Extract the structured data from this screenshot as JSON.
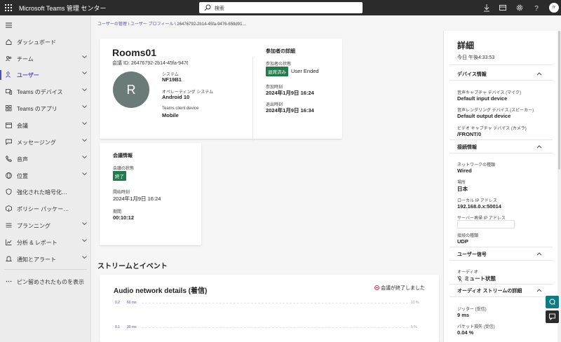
{
  "app": {
    "title": "Microsoft Teams 管理 センター"
  },
  "search": {
    "placeholder": "検索"
  },
  "user": {
    "initials": "IY"
  },
  "nav": {
    "items": [
      {
        "label": "ダッシュボード",
        "icon": "home-icon"
      },
      {
        "label": "チーム",
        "icon": "teams-icon",
        "expandable": true
      },
      {
        "label": "ユーザー",
        "icon": "users-icon",
        "expandable": true,
        "active": true
      },
      {
        "label": "Teams のデバイス",
        "icon": "devices-icon",
        "expandable": true
      },
      {
        "label": "Teams のアプリ",
        "icon": "apps-icon",
        "expandable": true
      },
      {
        "label": "会議",
        "icon": "meetings-icon",
        "expandable": true
      },
      {
        "label": "メッセージング",
        "icon": "messaging-icon",
        "expandable": true
      },
      {
        "label": "音声",
        "icon": "phone-icon",
        "expandable": true
      },
      {
        "label": "位置",
        "icon": "globe-icon",
        "expandable": true
      },
      {
        "label": "強化された暗号化…",
        "icon": "shield-icon"
      },
      {
        "label": "ポリシー パッケー…",
        "icon": "package-icon"
      },
      {
        "label": "プランニング",
        "icon": "planning-icon",
        "expandable": true
      },
      {
        "label": "分析 & レポート",
        "icon": "chart-icon",
        "expandable": true
      },
      {
        "label": "通知とアラート",
        "icon": "bell-icon",
        "expandable": true
      }
    ],
    "show_pinned": "ピン留めされたものを表示"
  },
  "breadcrumb": {
    "items": [
      "ユーザーの管理",
      "ユーザー プロフィール",
      "26476792-2b14-45fa-9476-658d91..."
    ],
    "separator": "\\"
  },
  "participant": {
    "device_name": "Rooms01",
    "meeting_id_label": "会議 ID:",
    "meeting_id": "26476792-2b14-45fa-9476",
    "avatar_letter": "R",
    "system_label": "システム",
    "system": "NF19B1",
    "os_label": "オペレーティング システム",
    "os": "Android 10",
    "client_label": "Teams client device",
    "client": "Mobile"
  },
  "participant_details": {
    "title": "参加者の詳細",
    "status_label": "参加者の状態",
    "status_badge": "退席済み",
    "status_text": "User Ended",
    "join_label": "参加時刻",
    "join": "2024年1月9日 16:24",
    "leave_label": "退出時刻",
    "leave": "2024年1月9日 16:34"
  },
  "meeting_info": {
    "title": "会議情報",
    "status_label": "会議の状態",
    "status_badge": "終了",
    "start_label": "開始時刻",
    "start": "2024年1月9日 16:24",
    "duration_label": "期間",
    "duration": "00:10:12"
  },
  "streams": {
    "title": "ストリームとイベント",
    "chart_title": "Audio network details (着信)",
    "ended_text": "会議が終了しました"
  },
  "chart_data": {
    "type": "line",
    "title": "Audio network details (着信)",
    "y_ticks_left": [
      {
        "value": "0.2",
        "label": "60 ms"
      },
      {
        "value": "0.1",
        "label": "30 ms"
      }
    ],
    "y_ticks_right": [
      "10 %",
      "5 %"
    ],
    "series": []
  },
  "details": {
    "title": "詳細",
    "time": "今日 午後4:33:53",
    "device_info": {
      "title": "デバイス情報",
      "mic_label": "音声キャプチャ デバイス (マイク)",
      "mic": "Default input device",
      "speaker_label": "音声レンダリング デバイス (スピーカー)",
      "speaker": "Default output device",
      "camera_label": "ビデオ キャプチャ デバイス (カメラ)",
      "camera": "/FRONT/0"
    },
    "connection": {
      "title": "接続情報",
      "network_label": "ネットワークの種類",
      "network": "Wired",
      "location_label": "場所",
      "location": "日本",
      "local_ip_label": "ローカル IP アドレス",
      "local_ip": "192.168.0.x:50014",
      "server_ip_label": "サーバー再帰 IP アドレス",
      "server_ip": "",
      "conn_type_label": "接続の種類",
      "conn_type": "UDP"
    },
    "user_signal": {
      "title": "ユーザー信号",
      "audio_label": "オーディオ",
      "audio": "ミュート状態"
    },
    "audio_stream": {
      "title": "オーディオ ストリームの詳細",
      "jitter_label": "ジッター (受信)",
      "jitter": "9 ms",
      "loss_label": "パケット損失 (受信)",
      "loss": "0.04 %"
    }
  },
  "colors": {
    "accent": "#4f52b2",
    "topbar": "#2b2b2b",
    "success": "#237b4b",
    "fab": "#0f7b84",
    "avatar": "#6a7b78"
  }
}
